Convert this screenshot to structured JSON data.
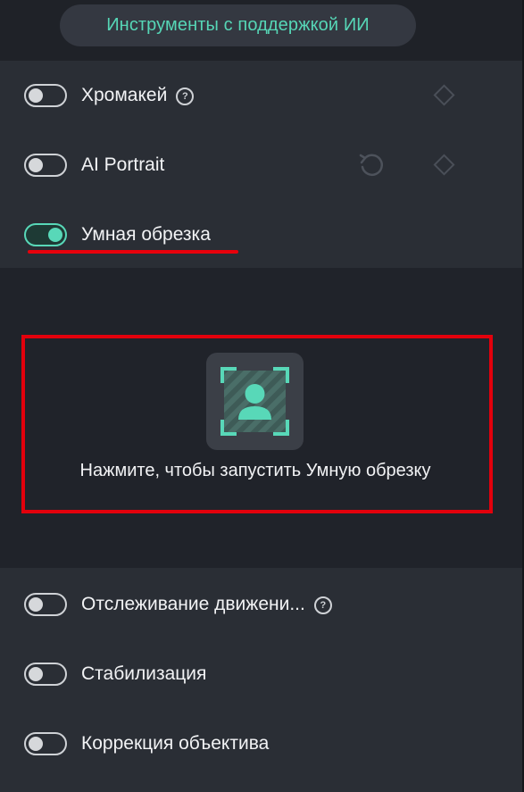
{
  "header": {
    "ai_tab_label": "Инструменты с поддержкой ИИ"
  },
  "tools_top": [
    {
      "label": "Хромакей",
      "enabled": false,
      "has_help": true,
      "has_reset": false,
      "has_keyframe": true
    },
    {
      "label": "AI Portrait",
      "enabled": false,
      "has_help": false,
      "has_reset": true,
      "has_keyframe": true
    },
    {
      "label": "Умная обрезка",
      "enabled": true,
      "has_help": false,
      "has_reset": false,
      "has_keyframe": false
    }
  ],
  "smart_crop": {
    "launch_text": "Нажмите, чтобы запустить Умную обрезку",
    "icon": "smart-crop-person-icon"
  },
  "tools_bottom": [
    {
      "label": "Отслеживание движени...",
      "enabled": false,
      "has_help": true
    },
    {
      "label": "Стабилизация",
      "enabled": false,
      "has_help": false
    },
    {
      "label": "Коррекция объектива",
      "enabled": false,
      "has_help": false
    }
  ],
  "icons": {
    "help": "question-circle-icon",
    "keyframe": "diamond-keyframe-icon",
    "reset": "reset-arrow-icon"
  },
  "colors": {
    "accent": "#58d8b8",
    "panel_bg": "#2a2e35",
    "page_bg": "#20232a",
    "highlight_red": "#e3000c"
  }
}
